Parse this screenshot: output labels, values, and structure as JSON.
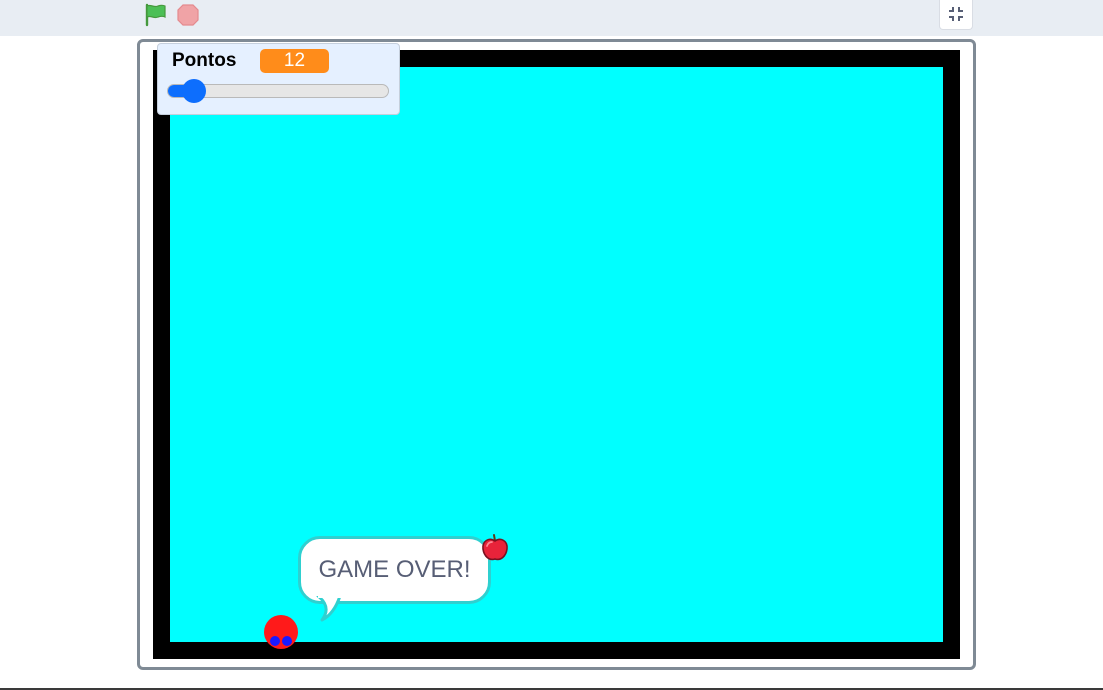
{
  "toolbar": {
    "green_flag_icon": "green-flag-icon",
    "stop_icon": "stop-sign-icon",
    "unfullscreen_icon": "unfullscreen-icon"
  },
  "monitor": {
    "label": "Pontos",
    "value": "12",
    "slider_fraction": 0.12,
    "value_color": "#ff8c1a"
  },
  "stage": {
    "background_color": "#00ffff",
    "border_color": "#000000",
    "speech_bubble": "GAME OVER!",
    "sprites": [
      "apple-sprite",
      "player-sprite"
    ]
  }
}
